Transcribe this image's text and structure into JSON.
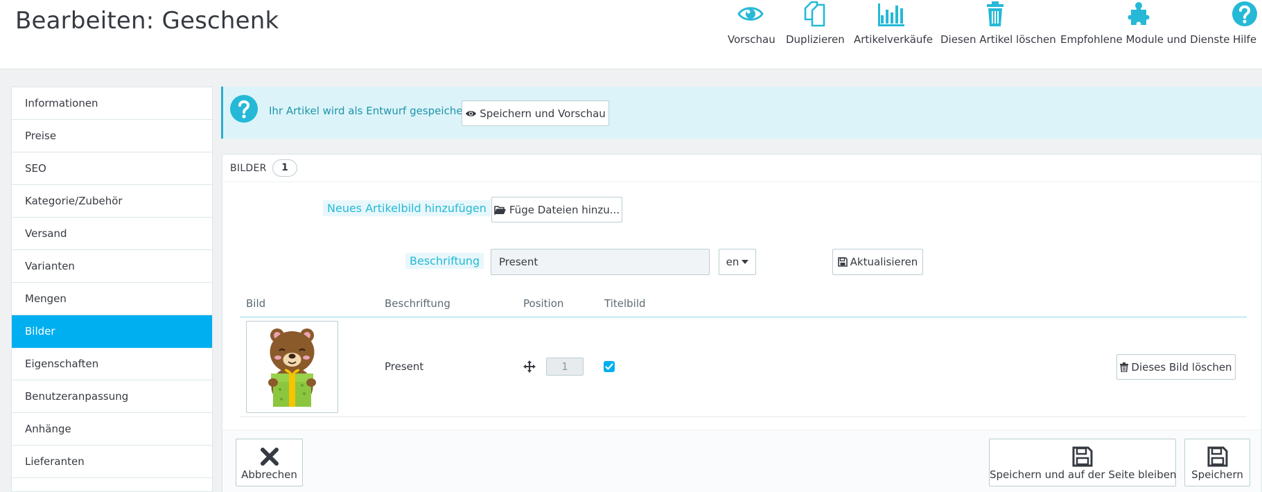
{
  "header": {
    "title": "Bearbeiten: Geschenk",
    "toolbar": [
      {
        "label": "Vorschau",
        "icon": "eye-icon"
      },
      {
        "label": "Duplizieren",
        "icon": "copy-icon"
      },
      {
        "label": "Artikelverkäufe",
        "icon": "bar-chart-icon"
      },
      {
        "label": "Diesen Artikel löschen",
        "icon": "trash-icon"
      },
      {
        "label": "Empfohlene Module und Dienste",
        "icon": "puzzle-icon"
      },
      {
        "label": "Hilfe",
        "icon": "help-icon"
      }
    ],
    "accent": "#25b9d7"
  },
  "sidebar": {
    "items": [
      {
        "label": "Informationen"
      },
      {
        "label": "Preise"
      },
      {
        "label": "SEO"
      },
      {
        "label": "Kategorie/Zubehör"
      },
      {
        "label": "Versand"
      },
      {
        "label": "Varianten"
      },
      {
        "label": "Mengen"
      },
      {
        "label": "Bilder",
        "active": true
      },
      {
        "label": "Eigenschaften"
      },
      {
        "label": "Benutzeranpassung"
      },
      {
        "label": "Anhänge"
      },
      {
        "label": "Lieferanten"
      }
    ],
    "active_color": "#00aff0"
  },
  "alert": {
    "message": "Ihr Artikel wird als Entwurf gespeichert.",
    "button": "Speichern und Vorschau"
  },
  "images_panel": {
    "title": "BILDER",
    "count": "1",
    "add_label": "Neues Artikelbild hinzufügen",
    "add_button": "Füge Dateien hinzu...",
    "caption_label": "Beschriftung",
    "caption_value": "Present",
    "language": "en",
    "update_button": "Aktualisieren",
    "columns": [
      "Bild",
      "Beschriftung",
      "Position",
      "Titelbild"
    ],
    "rows": [
      {
        "caption": "Present",
        "position": "1",
        "cover": true,
        "delete_label": "Dieses Bild löschen"
      }
    ]
  },
  "footer": {
    "cancel": "Abbrechen",
    "save_stay": "Speichern und auf der Seite bleiben",
    "save": "Speichern"
  }
}
